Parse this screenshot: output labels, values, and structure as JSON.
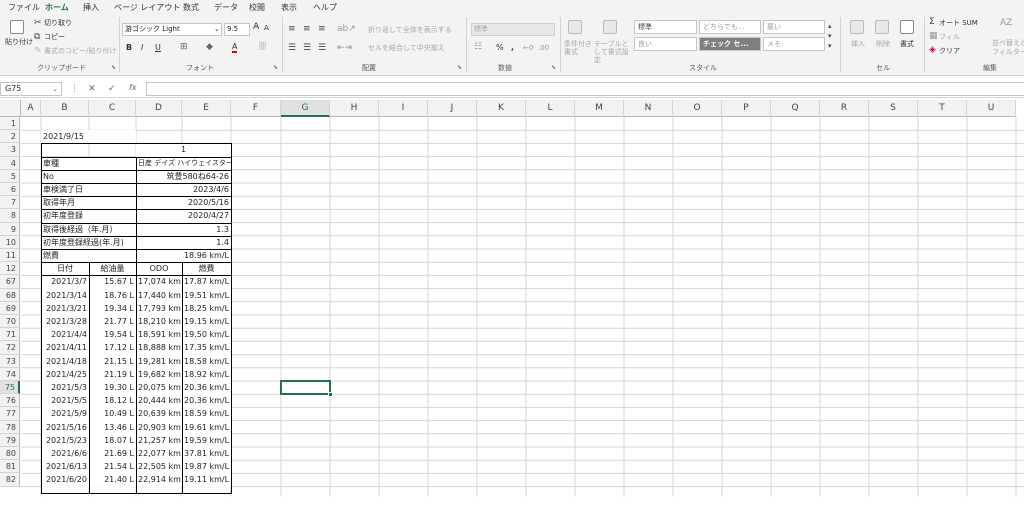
{
  "menu": {
    "tabs": [
      "ファイル",
      "ホーム",
      "挿入",
      "ページ レイアウト",
      "数式",
      "データ",
      "校閲",
      "表示",
      "ヘルプ"
    ]
  },
  "ribbon": {
    "clipboard": {
      "paste": "貼り付け",
      "cut": "切り取り",
      "copy": "コピー",
      "format_painter": "書式のコピー/貼り付け",
      "group": "クリップボード"
    },
    "font": {
      "name": "游ゴシック Light",
      "size": "9.5",
      "grow": "A",
      "shrink": "A",
      "bold": "B",
      "italic": "I",
      "underline": "U",
      "fontcolor": "A",
      "group": "フォント"
    },
    "align": {
      "wrap": "折り返して全体を表示する",
      "merge": "セルを結合して中央揃え",
      "group": "配置"
    },
    "number": {
      "format": "標準",
      "percent": "%",
      "comma": ",",
      "group": "数値"
    },
    "styles": {
      "cond": "条件付き書式",
      "table": "テーブルとして書式設定",
      "items": [
        "標準",
        "どちらでも...",
        "悪い",
        "良い",
        "チェック セ...",
        "メモ"
      ],
      "group": "スタイル"
    },
    "cells": {
      "insert": "挿入",
      "delete": "削除",
      "format": "書式",
      "group": "セル"
    },
    "editing": {
      "autosum": "オート SUM",
      "fill": "フィル",
      "clear": "クリア",
      "sort": "並べ替えと",
      "filter": "フィルター",
      "group": "編集"
    }
  },
  "formula": {
    "namebox": "G75",
    "fx": "fx",
    "value": ""
  },
  "columns": [
    "A",
    "B",
    "C",
    "D",
    "E",
    "F",
    "G",
    "H",
    "I",
    "J",
    "K",
    "L",
    "M",
    "N",
    "O",
    "P",
    "Q",
    "R",
    "S",
    "T",
    "U"
  ],
  "selected_col": "G",
  "selected_row": "75",
  "header": {
    "date": "2021/9/15",
    "num": "1",
    "rows": [
      {
        "label": "車種",
        "value": "日産 デイズ ハイウェイスターX"
      },
      {
        "label": "No",
        "value": "筑豊580ね64-26"
      },
      {
        "label": "車検満了日",
        "value": "2023/4/6"
      },
      {
        "label": "取得年月",
        "value": "2020/5/16"
      },
      {
        "label": "初年度登録",
        "value": "2020/4/27"
      },
      {
        "label": "取得後経過（年.月）",
        "value": "1.3"
      },
      {
        "label": "初年度登録経過(年.月)",
        "value": "1.4"
      },
      {
        "label": "燃費",
        "value": "18.96 km/L"
      }
    ]
  },
  "table": {
    "columns": [
      "日付",
      "給油量",
      "ODO",
      "燃費"
    ],
    "rows": [
      {
        "n": "67",
        "d": "2021/3/7",
        "q": "15.67 L",
        "o": "17,074 km",
        "e": "17.87 km/L"
      },
      {
        "n": "68",
        "d": "2021/3/14",
        "q": "18.76 L",
        "o": "17,440 km",
        "e": "19.51 km/L"
      },
      {
        "n": "69",
        "d": "2021/3/21",
        "q": "19.34 L",
        "o": "17,793 km",
        "e": "18.25 km/L"
      },
      {
        "n": "70",
        "d": "2021/3/28",
        "q": "21.77 L",
        "o": "18,210 km",
        "e": "19.15 km/L"
      },
      {
        "n": "71",
        "d": "2021/4/4",
        "q": "19.54 L",
        "o": "18,591 km",
        "e": "19.50 km/L"
      },
      {
        "n": "72",
        "d": "2021/4/11",
        "q": "17.12 L",
        "o": "18,888 km",
        "e": "17.35 km/L"
      },
      {
        "n": "73",
        "d": "2021/4/18",
        "q": "21.15 L",
        "o": "19,281 km",
        "e": "18.58 km/L"
      },
      {
        "n": "74",
        "d": "2021/4/25",
        "q": "21.19 L",
        "o": "19,682 km",
        "e": "18.92 km/L"
      },
      {
        "n": "75",
        "d": "2021/5/3",
        "q": "19.30 L",
        "o": "20,075 km",
        "e": "20.36 km/L"
      },
      {
        "n": "76",
        "d": "2021/5/5",
        "q": "18.12 L",
        "o": "20,444 km",
        "e": "20.36 km/L"
      },
      {
        "n": "77",
        "d": "2021/5/9",
        "q": "10.49 L",
        "o": "20,639 km",
        "e": "18.59 km/L"
      },
      {
        "n": "78",
        "d": "2021/5/16",
        "q": "13.46 L",
        "o": "20,903 km",
        "e": "19.61 km/L"
      },
      {
        "n": "79",
        "d": "2021/5/23",
        "q": "18.07 L",
        "o": "21,257 km",
        "e": "19.59 km/L"
      },
      {
        "n": "80",
        "d": "2021/6/6",
        "q": "21.69 L",
        "o": "22,077 km",
        "e": "37.81 km/L"
      },
      {
        "n": "81",
        "d": "2021/6/13",
        "q": "21.54 L",
        "o": "22,505 km",
        "e": "19.87 km/L"
      },
      {
        "n": "82",
        "d": "2021/6/20",
        "q": "21.40 L",
        "o": "22,914 km",
        "e": "19.11 km/L"
      }
    ]
  },
  "colors": {
    "accent": "#217346",
    "ribbon": "#f3f3f3",
    "grid": "#d4d4d4"
  }
}
